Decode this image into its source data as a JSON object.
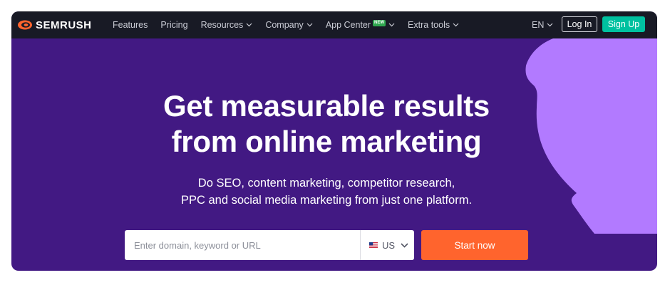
{
  "brand": {
    "name": "SEMRUSH",
    "logo_icon": "semrush-flame-logo",
    "colors": {
      "nav_bg": "#181a25",
      "hero_bg": "#421983",
      "decor": "#b27aff",
      "signup": "#00c1a0",
      "start": "#ff642d"
    }
  },
  "nav": {
    "items": [
      {
        "label": "Features",
        "dropdown": false
      },
      {
        "label": "Pricing",
        "dropdown": false
      },
      {
        "label": "Resources",
        "dropdown": true
      },
      {
        "label": "Company",
        "dropdown": true
      },
      {
        "label": "App Center",
        "dropdown": true,
        "badge": "NEW"
      },
      {
        "label": "Extra tools",
        "dropdown": true
      }
    ],
    "language": "EN",
    "login_label": "Log In",
    "signup_label": "Sign Up"
  },
  "hero": {
    "headline_line1": "Get measurable results",
    "headline_line2": "from online marketing",
    "sub_line1": "Do SEO, content marketing, competitor research,",
    "sub_line2": "PPC and social media marketing from just one platform.",
    "search": {
      "placeholder": "Enter domain, keyword or URL",
      "value": "",
      "database": "US",
      "database_icon": "us-flag-icon"
    },
    "cta_label": "Start now"
  }
}
